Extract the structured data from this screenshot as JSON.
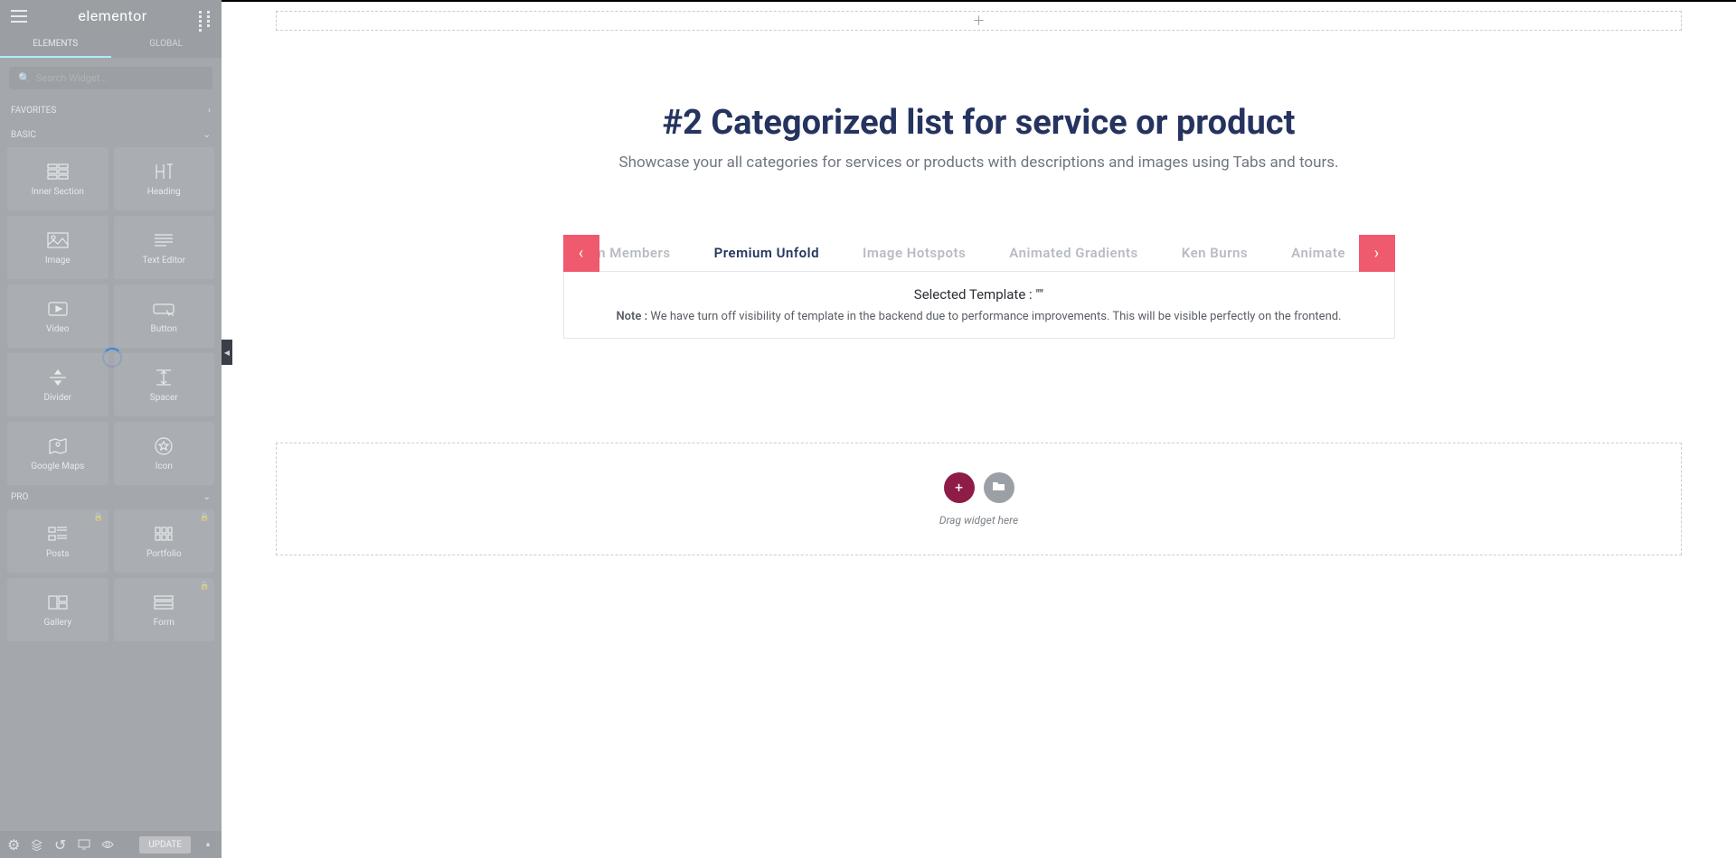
{
  "sidebar": {
    "logo": "elementor",
    "tabs": {
      "elements": "ELEMENTS",
      "global": "GLOBAL"
    },
    "search_placeholder": "Search Widget...",
    "sections": {
      "favorites": "FAVORITES",
      "basic": "BASIC",
      "pro": "PRO"
    },
    "basic_widgets": [
      {
        "label": "Inner Section"
      },
      {
        "label": "Heading"
      },
      {
        "label": "Image"
      },
      {
        "label": "Text Editor"
      },
      {
        "label": "Video"
      },
      {
        "label": "Button"
      },
      {
        "label": "Divider"
      },
      {
        "label": "Spacer"
      },
      {
        "label": "Google Maps"
      },
      {
        "label": "Icon"
      }
    ],
    "pro_widgets": [
      {
        "label": "Posts",
        "locked": true
      },
      {
        "label": "Portfolio",
        "locked": true
      },
      {
        "label": "Gallery",
        "locked": false
      },
      {
        "label": "Form",
        "locked": true
      }
    ],
    "footer": {
      "update": "UPDATE"
    }
  },
  "canvas": {
    "title": "#2 Categorized list for service or product",
    "subtitle": "Showcase your all categories for services or products with descriptions and images using Tabs and tours.",
    "carousel_tabs": [
      {
        "label": "m Members",
        "active": false,
        "cut": true
      },
      {
        "label": "Premium Unfold",
        "active": true
      },
      {
        "label": "Image Hotspots",
        "active": false
      },
      {
        "label": "Animated Gradients",
        "active": false
      },
      {
        "label": "Ken Burns",
        "active": false
      },
      {
        "label": "Animate",
        "active": false,
        "cut_right": true
      }
    ],
    "template_box": {
      "selected": "Selected Template : \"\"",
      "note_label": "Note : ",
      "note_text": "We have turn off visibility of template in the backend due to performance improvements. This will be visible perfectly on the frontend."
    },
    "dropzone": {
      "label": "Drag widget here"
    }
  },
  "colors": {
    "accent_pink": "#ef5a6f",
    "dark_blue": "#24355f",
    "maroon": "#8e1c47"
  }
}
